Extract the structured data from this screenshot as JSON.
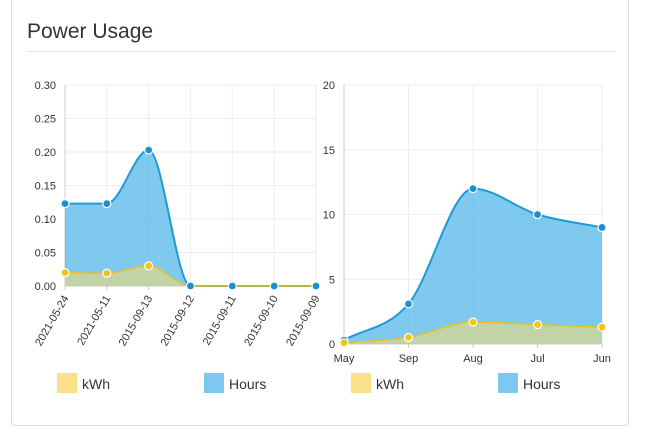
{
  "panel": {
    "title": "Power Usage"
  },
  "colors": {
    "kwh_fill": "rgba(250,220,110,0.55)",
    "kwh_line": "#e8c21c",
    "kwh_point": "#f0c419",
    "hours_fill": "rgba(66,176,230,0.68)",
    "hours_line": "#1e9ad6",
    "hours_point": "#1890d4",
    "grid": "#eeeeee",
    "legend_kwh": "#fbe08a",
    "legend_hours": "#7dc8ee"
  },
  "chart_data": [
    {
      "type": "area",
      "categories": [
        "2021-05-24",
        "2021-05-11",
        "2015-09-13",
        "2015-09-12",
        "2015-09-11",
        "2015-09-10",
        "2015-09-09"
      ],
      "series": [
        {
          "name": "kWh",
          "values": [
            0.02,
            0.019,
            0.03,
            0.0,
            0.0,
            0.0,
            0.0
          ]
        },
        {
          "name": "Hours",
          "values": [
            0.123,
            0.123,
            0.203,
            0.0,
            0.0,
            0.0,
            0.0
          ]
        }
      ],
      "yticks": [
        "0.00",
        "0.05",
        "0.10",
        "0.15",
        "0.20",
        "0.25",
        "0.30"
      ],
      "ylim": [
        0,
        0.3
      ],
      "grid": true,
      "legend": [
        {
          "label": "kWh"
        },
        {
          "label": "Hours"
        }
      ],
      "legend_placement": "bottom"
    },
    {
      "type": "area",
      "categories": [
        "May",
        "Sep",
        "Aug",
        "Jul",
        "Jun"
      ],
      "series": [
        {
          "name": "kWh",
          "values": [
            0.1,
            0.5,
            1.7,
            1.5,
            1.3
          ]
        },
        {
          "name": "Hours",
          "values": [
            0.3,
            3.1,
            12.0,
            10.0,
            9.0
          ]
        }
      ],
      "yticks": [
        "0",
        "5",
        "10",
        "15",
        "20"
      ],
      "ylim": [
        0,
        20
      ],
      "grid": true,
      "legend": [
        {
          "label": "kWh"
        },
        {
          "label": "Hours"
        }
      ],
      "legend_placement": "bottom"
    }
  ]
}
